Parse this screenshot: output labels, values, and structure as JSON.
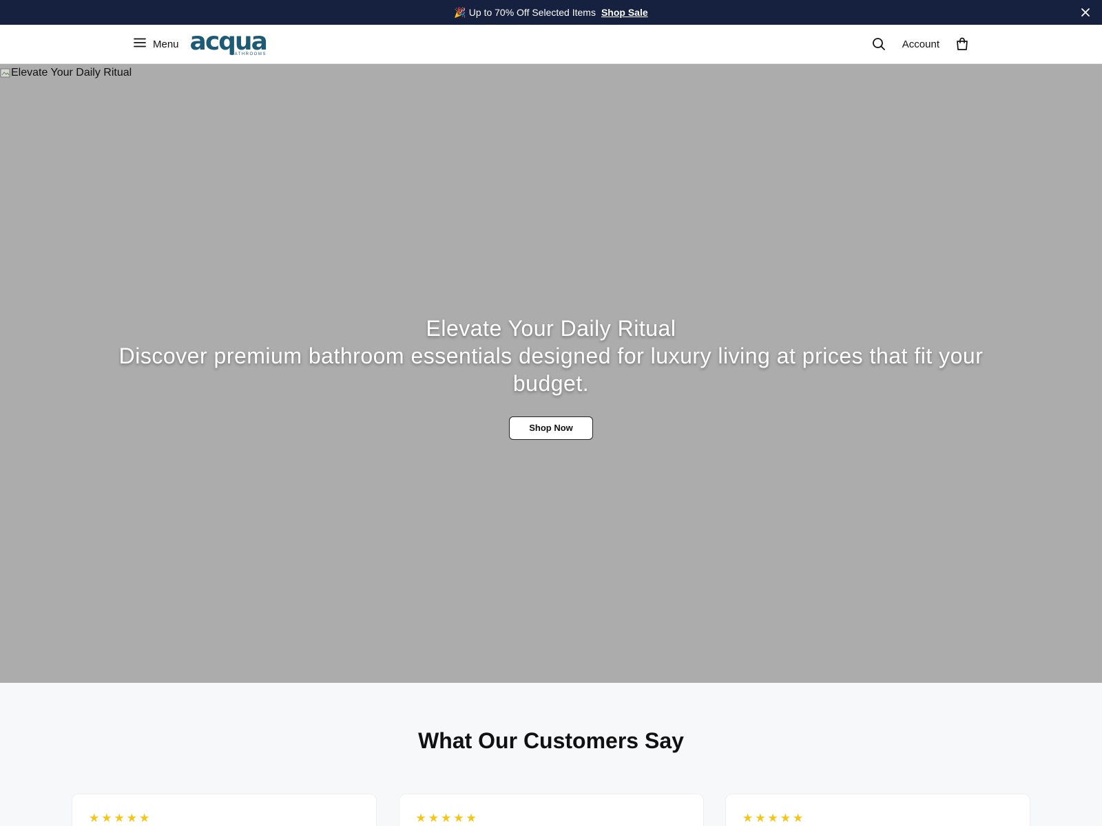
{
  "announcement": {
    "emoji": "🎉",
    "message": "Up to 70% Off Selected Items",
    "link_label": "Shop Sale",
    "close_icon": "close-icon"
  },
  "header": {
    "menu_label": "Menu",
    "logo_word": "acqua",
    "logo_sub": "BATHROOMS",
    "account_label": "Account",
    "icons": [
      "menu-icon",
      "search-icon",
      "shopping-bag-icon"
    ]
  },
  "hero": {
    "image_alt": "Elevate Your Daily Ritual",
    "title": "Elevate Your Daily Ritual",
    "subtitle": "Discover premium bathroom essentials designed for luxury living at prices that fit your budget.",
    "cta_label": "Shop Now"
  },
  "testimonials": {
    "heading": "What Our Customers Say",
    "cards": [
      {
        "stars": "★★★★★"
      },
      {
        "stars": "★★★★★"
      },
      {
        "stars": "★★★★★"
      }
    ]
  },
  "colors": {
    "announcement_bg": "#16213f",
    "brand": "#1d5a76",
    "hero_placeholder": "#acacac",
    "star": "#f5c518"
  }
}
